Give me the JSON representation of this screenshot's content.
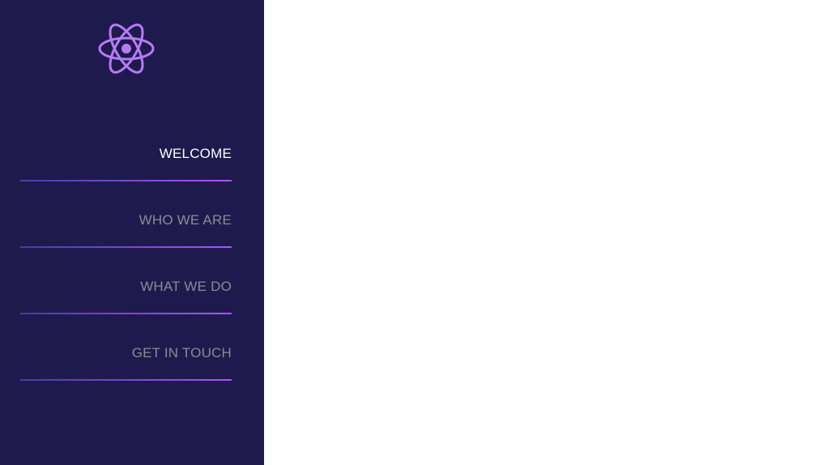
{
  "colors": {
    "sidebar_bg": "#1f1a4d",
    "accent": "#b57cf5",
    "active_text": "#ffffff",
    "inactive_text": "#8b8a99",
    "underline_start": "#4b3aa6",
    "underline_end": "#a855f7"
  },
  "logo": {
    "icon": "atom-icon"
  },
  "nav": {
    "items": [
      {
        "label": "WELCOME",
        "active": true
      },
      {
        "label": "WHO WE ARE",
        "active": false
      },
      {
        "label": "WHAT WE DO",
        "active": false
      },
      {
        "label": "GET IN TOUCH",
        "active": false
      }
    ]
  }
}
